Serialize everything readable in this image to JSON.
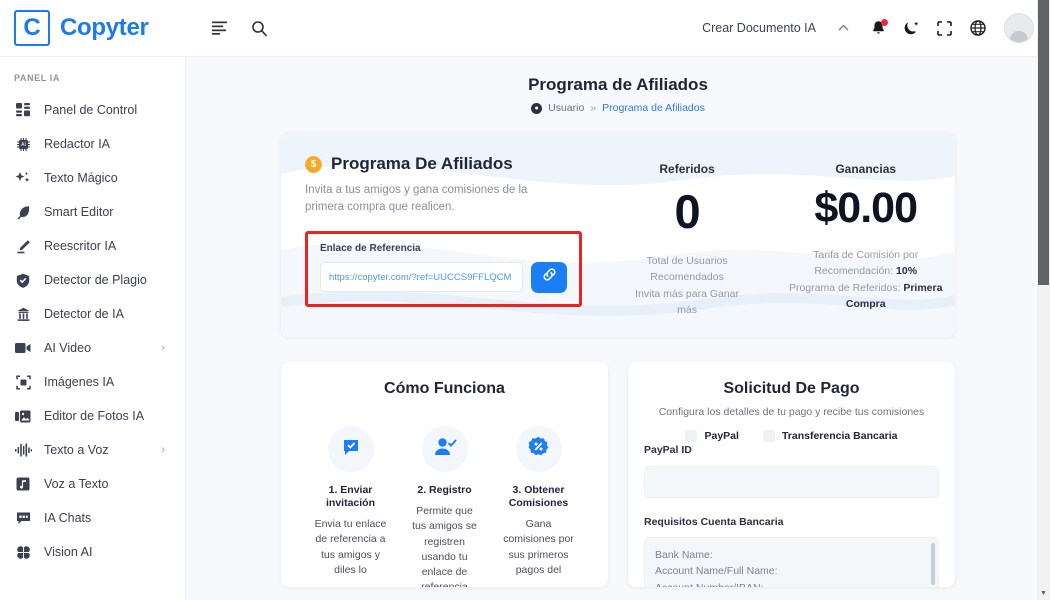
{
  "brand": {
    "logo_letter": "C",
    "name": "Copyter"
  },
  "topbar": {
    "menu_icon": "menu-icon",
    "search_icon": "search-icon",
    "create_doc_label": "Crear Documento IA",
    "chevron": "⌃",
    "notification_icon": "bell-icon",
    "theme_icon": "moon-icon",
    "fullscreen_icon": "fullscreen-icon",
    "language_icon": "globe-icon",
    "avatar": "user-avatar"
  },
  "sidebar": {
    "section_label": "PANEL IA",
    "items": [
      {
        "label": "Panel de Control",
        "icon": "dashboard-icon",
        "arrow": ""
      },
      {
        "label": "Redactor IA",
        "icon": "chip-icon",
        "arrow": ""
      },
      {
        "label": "Texto Mágico",
        "icon": "sparkles-icon",
        "arrow": ""
      },
      {
        "label": "Smart Editor",
        "icon": "feather-icon",
        "arrow": ""
      },
      {
        "label": "Reescritor IA",
        "icon": "pencil-icon",
        "arrow": ""
      },
      {
        "label": "Detector de Plagio",
        "icon": "shield-check-icon",
        "arrow": ""
      },
      {
        "label": "Detector de IA",
        "icon": "robot-icon",
        "arrow": ""
      },
      {
        "label": "AI Video",
        "icon": "video-icon",
        "arrow": "›"
      },
      {
        "label": "Imágenes IA",
        "icon": "image-frame-icon",
        "arrow": ""
      },
      {
        "label": "Editor de Fotos IA",
        "icon": "photo-edit-icon",
        "arrow": ""
      },
      {
        "label": "Texto a Voz",
        "icon": "waveform-icon",
        "arrow": "›"
      },
      {
        "label": "Voz a Texto",
        "icon": "music-note-icon",
        "arrow": ""
      },
      {
        "label": "IA Chats",
        "icon": "chat-icon",
        "arrow": ""
      },
      {
        "label": "Vision AI",
        "icon": "brain-icon",
        "arrow": ""
      }
    ]
  },
  "page": {
    "title": "Programa de Afiliados",
    "breadcrumb": {
      "icon": "user-circle-icon",
      "root": "Usuario",
      "separator": "»",
      "current": "Programa de Afiliados"
    }
  },
  "hero": {
    "badge_icon": "coin-icon",
    "badge_symbol": "$",
    "title": "Programa De Afiliados",
    "subtitle": "Invita a tus amigos y gana comisiones de la primera compra que realicen.",
    "referral": {
      "label": "Enlace de Referencia",
      "url": "https://copyter.com/?ref=UUCCS9FFLQCM",
      "copy_icon": "link-icon",
      "highlight_color": "#ee2222"
    },
    "stats": [
      {
        "label": "Referidos",
        "value": "0",
        "note_lines": [
          "Total de Usuarios",
          "Recomendados",
          "Invita más para Ganar",
          "más"
        ]
      },
      {
        "label": "Ganancias",
        "value": "$0.00",
        "note_prefix1": "Tarifa de Comisión por",
        "note_prefix2": "Recomendación: ",
        "note_bold1": "10%",
        "note_prefix3": "Programa de Referidos: ",
        "note_bold2": "Primera Compra"
      }
    ]
  },
  "how_it_works": {
    "title": "Cómo Funciona",
    "steps": [
      {
        "icon": "chat-check-icon",
        "title": "1. Enviar invitación",
        "desc": "Envia tu enlace de referencia a tus amigos y diles lo"
      },
      {
        "icon": "user-check-icon",
        "title": "2. Registro",
        "desc": "Permite que tus amigos se registren usando tu enlace de referencia"
      },
      {
        "icon": "percent-badge-icon",
        "title": "3. Obtener Comisiones",
        "desc": "Gana comisiones por sus primeros pagos del"
      }
    ]
  },
  "payment": {
    "title": "Solicitud De Pago",
    "subtitle": "Configura los detalles de tu pago y recibe tus comisiones",
    "methods": [
      {
        "label": "PayPal",
        "selected": false
      },
      {
        "label": "Transferencia Bancaria",
        "selected": false
      }
    ],
    "paypal_label": "PayPal ID",
    "paypal_value": "",
    "bank_label": "Requisitos Cuenta Bancaria",
    "bank_placeholder": "Bank Name:\nAccount Name/Full Name:\nAccount Number/IBAN:"
  },
  "colors": {
    "brand_blue": "#1b79f2",
    "accent_red": "#ee2222",
    "coin_orange": "#f9a825",
    "page_bg": "#f7f9fc"
  }
}
